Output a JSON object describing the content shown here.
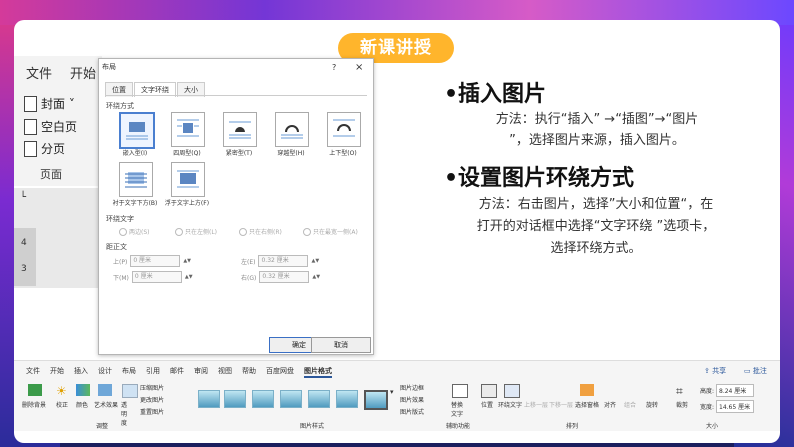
{
  "slide": {
    "badge": "新课讲授",
    "heading1": "•插入图片",
    "para1_line1": "方法：执行“插入” →“插图”→“图片",
    "para1_line2": "”，选择图片来源，插入图片。",
    "heading2": "•设置图片环绕方式",
    "para2_line1": "方法：右击图片，选择”大小和位置“，在",
    "para2_line2": "打开的对话框中选择“文字环绕 ”选项卡，",
    "para2_line3": "选择环绕方式。"
  },
  "left_ribbon": {
    "tab_file": "文件",
    "tab_start": "开始",
    "item_cover": "封面 ˅",
    "item_blank": "空白页",
    "item_break": "分页",
    "group_label": "页面",
    "ruler_marks": [
      "4",
      "3"
    ]
  },
  "dialog": {
    "title": "布局",
    "help": "?",
    "close": "×",
    "tabs": [
      "位置",
      "文字环绕",
      "大小"
    ],
    "section_wrap_style": "环绕方式",
    "wrap_options": [
      "嵌入型(I)",
      "四周型(Q)",
      "紧密型(T)",
      "穿越型(H)",
      "上下型(O)",
      "衬于文字下方(B)",
      "浮于文字上方(F)"
    ],
    "section_wrap_text": "环绕文字",
    "wrap_text_options": [
      "两边(S)",
      "只在左侧(L)",
      "只在右侧(R)",
      "只在最宽一侧(A)"
    ],
    "section_distance": "距正文",
    "dist_top_label": "上(P)",
    "dist_top_value": "0 厘米",
    "dist_bottom_label": "下(M)",
    "dist_bottom_value": "0 厘米",
    "dist_left_label": "左(E)",
    "dist_left_value": "0.32 厘米",
    "dist_right_label": "右(G)",
    "dist_right_value": "0.32 厘米",
    "ok": "确定",
    "cancel": "取消"
  },
  "bottom_ribbon": {
    "tabs": [
      "文件",
      "开始",
      "插入",
      "设计",
      "布局",
      "引用",
      "邮件",
      "审阅",
      "视图",
      "帮助",
      "百度网盘",
      "图片格式"
    ],
    "share": "共享",
    "comments": "批注",
    "remove_bg": "删除背景",
    "correct": "校正",
    "color": "颜色",
    "artistic": "艺术效果",
    "transparency": "透明度",
    "compress": "压缩图片",
    "change_pic": "更改图片",
    "reset_pic": "重置图片",
    "group_adjust": "调整",
    "group_styles": "图片样式",
    "border": "图片边框",
    "effects": "图片效果",
    "layout": "图片版式",
    "alt_text": "替换文字",
    "group_access": "辅助功能",
    "position": "位置",
    "wrap_text": "环绕文字",
    "forward": "上移一层",
    "backward": "下移一层",
    "select_pane": "选择窗格",
    "align": "对齐",
    "group": "组合",
    "rotate": "旋转",
    "group_arrange": "排列",
    "crop": "裁剪",
    "height_label": "高度:",
    "height_value": "8.24 厘米",
    "width_label": "宽度:",
    "width_value": "14.65 厘米",
    "group_size": "大小"
  }
}
